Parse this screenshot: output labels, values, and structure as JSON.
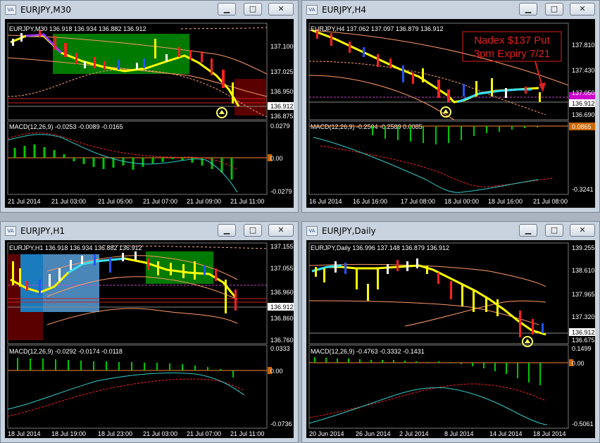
{
  "windows": [
    {
      "title": "EURJPY,M30",
      "quote": "EURJPY,M30  136.918 136.934 136.882 136.912",
      "price_labels": [
        "137.100",
        "137.025",
        "136.950",
        "136.875"
      ],
      "current_price": "136.912",
      "macd_header": "MACD(12,26,9) -0.0253 -0.0089 -0.0165",
      "macd_labels": [
        "0.0279",
        "0.00",
        "-0.0279"
      ],
      "time_labels": [
        "21 Jul 2014",
        "21 Jul 03:00",
        "21 Jul 05:00",
        "21 Jul 07:00",
        "21 Jul 09:00",
        "21 Jul 11:00"
      ]
    },
    {
      "title": "EURJPY,H4",
      "quote": "EURJPY,H4  137.062 137.097 136.879 136.912",
      "price_labels": [
        "137.810",
        "137.430",
        "137.050",
        "136.690"
      ],
      "current_price": "136.912",
      "annotation": [
        "Nadex $137 Put",
        "3pm Expiry 7/21"
      ],
      "macd_header": "MACD(12,26,9) -0.2504 -0.2589 0.0085",
      "macd_labels": [
        "0.0865",
        "-0.3241"
      ],
      "time_labels": [
        "16 Jul 2014",
        "16 Jul 16:00",
        "17 Jul 08:00",
        "18 Jul 00:00",
        "18 Jul 16:00",
        "21 Jul 08:00"
      ]
    },
    {
      "title": "EURJPY,H1",
      "quote": "EURJPY,H1  136.918 136.934 136.882 136.912",
      "price_labels": [
        "137.155",
        "137.055",
        "136.960",
        "136.860",
        "136.760"
      ],
      "current_price": "136.912",
      "macd_header": "MACD(12,26,9) -0.0292 -0.0174 -0.0118",
      "macd_labels": [
        "0.0333",
        "0.00",
        "-0.0736"
      ],
      "time_labels": [
        "18 Jul 2014",
        "18 Jul 19:00",
        "18 Jul 23:00",
        "21 Jul 03:00",
        "21 Jul 07:00",
        "21 Jul 11:00"
      ]
    },
    {
      "title": "EURJPY,Daily",
      "quote": "EURJPY,Daily  136.996 137.148 136.879 136.912",
      "price_labels": [
        "139.255",
        "138.610",
        "137.965",
        "137.320",
        "136.675"
      ],
      "current_price": "136.912",
      "macd_header": "MACD(12,26,9) -0.4763 -0.3332 -0.1431",
      "macd_labels": [
        "0.1499",
        "0.00",
        "-0.5061"
      ],
      "time_labels": [
        "20 Jun 2014",
        "26 Jun 2014",
        "2 Jul 2014",
        "8 Jul 2014",
        "14 Jul 2014",
        "18 Jul 2014"
      ]
    }
  ],
  "icons": {
    "window": "chart-window-icon",
    "minimize": "minimize-icon",
    "maximize": "maximize-icon",
    "close": "close-icon"
  },
  "colors": {
    "bull": "#ffffff",
    "bear": "#ff2020",
    "trend": "#ffff00",
    "envelope": "#ff9966",
    "macd_hist": "#00c800",
    "macd_signal": "#ff2020",
    "macd_line": "#33cccc",
    "zone_green": "#007a00",
    "zone_red": "#5a0000",
    "zone_blue": "#4a86b8"
  }
}
